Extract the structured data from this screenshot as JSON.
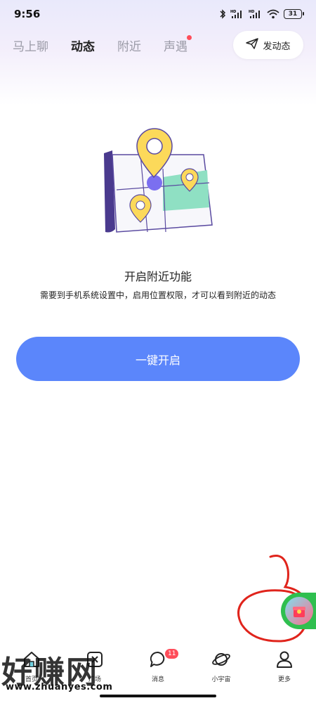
{
  "status_bar": {
    "time": "9:56",
    "battery": "31",
    "icons": [
      "bluetooth-icon",
      "hd-signal-icon",
      "hd-signal-icon",
      "wifi-icon",
      "battery-icon"
    ]
  },
  "tabs": [
    {
      "label": "马上聊",
      "active": false
    },
    {
      "label": "动态",
      "active": true
    },
    {
      "label": "附近",
      "active": false
    },
    {
      "label": "声遇",
      "active": false,
      "dot": true
    }
  ],
  "post_button": {
    "label": "发动态",
    "icon": "send-icon"
  },
  "empty_state": {
    "illustration": "map-pin-icon",
    "title": "开启附近功能",
    "description": "需要到手机系统设置中，启用位置权限，才可以看到附近的动态",
    "button_label": "一键开启"
  },
  "bottom_nav": [
    {
      "label": "首页",
      "icon": "home-icon"
    },
    {
      "label": "广场",
      "icon": "square-icon",
      "badge": ""
    },
    {
      "label": "消息",
      "icon": "message-icon",
      "badge": "11"
    },
    {
      "label": "小宇宙",
      "icon": "planet-icon"
    },
    {
      "label": "更多",
      "icon": "person-icon"
    }
  ],
  "watermark": {
    "text": "好赚网",
    "url": "www.zhuanyes.com"
  },
  "colors": {
    "accent": "#5b86fb",
    "badge": "#ff4d5a",
    "widget": "#2fbf4f",
    "annotation": "#e0241c"
  }
}
